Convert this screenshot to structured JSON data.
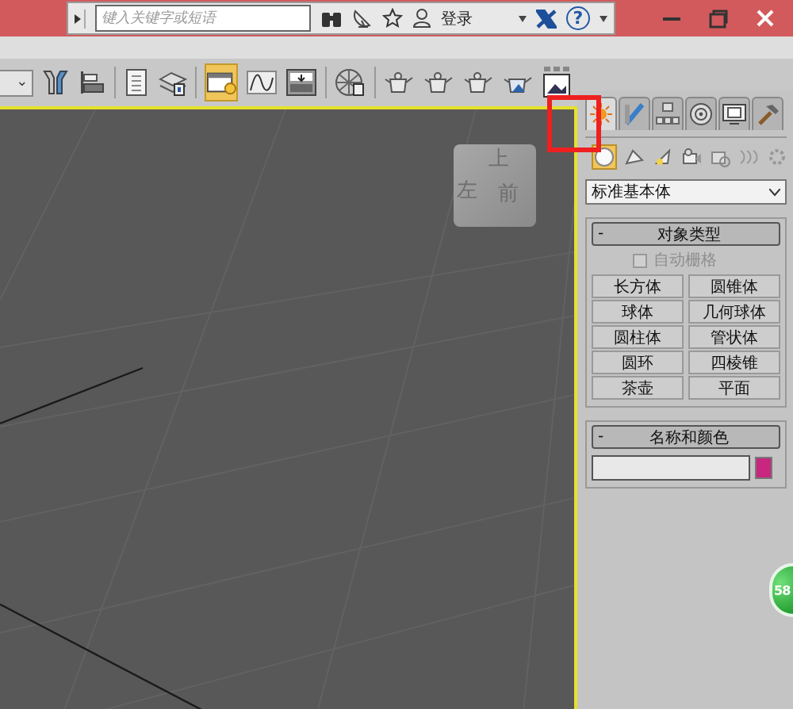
{
  "title_bar": {
    "search": {
      "placeholder": "键入关键字或短语"
    },
    "login": "登录",
    "help": "?"
  },
  "toolbar": {
    "dropdown_caret": "⌄",
    "tools": [
      {
        "kind": "mirror",
        "selected": false
      },
      {
        "kind": "align",
        "selected": false
      },
      {
        "kind": "list",
        "selected": false
      },
      {
        "kind": "layers",
        "selected": false
      },
      {
        "kind": "folder",
        "selected": true
      },
      {
        "kind": "curve",
        "selected": false
      },
      {
        "kind": "schematic",
        "selected": false
      },
      {
        "kind": "sphere",
        "selected": false
      },
      {
        "kind": "teapot",
        "selected": false
      },
      {
        "kind": "teapot",
        "selected": false
      },
      {
        "kind": "teapot",
        "selected": false
      },
      {
        "kind": "teapot-blue",
        "selected": false
      },
      {
        "kind": "frame",
        "selected": false
      }
    ]
  },
  "viewcube": {
    "faces": [
      "上",
      "左",
      "前"
    ]
  },
  "command_panel": {
    "tabs": [
      {
        "kind": "create",
        "selected": true
      },
      {
        "kind": "modify",
        "selected": false
      },
      {
        "kind": "hierarchy",
        "selected": false
      },
      {
        "kind": "motion",
        "selected": false
      },
      {
        "kind": "display",
        "selected": false
      },
      {
        "kind": "utilities",
        "selected": false
      }
    ],
    "categories": [
      {
        "kind": "geometry",
        "selected": true
      },
      {
        "kind": "shapes",
        "selected": false
      },
      {
        "kind": "lights",
        "selected": false
      },
      {
        "kind": "cameras",
        "selected": false
      },
      {
        "kind": "helpers",
        "selected": false
      },
      {
        "kind": "spacewarps",
        "selected": false
      },
      {
        "kind": "systems",
        "selected": false
      }
    ],
    "dropdown": {
      "value": "标准基本体"
    },
    "object_type": {
      "collapse": "-",
      "title": "对象类型",
      "autogrid": {
        "label": "自动栅格",
        "checked": false,
        "disabled": true
      },
      "buttons": [
        "长方体",
        "圆锥体",
        "球体",
        "几何球体",
        "圆柱体",
        "管状体",
        "圆环",
        "四棱锥",
        "茶壶",
        "平面"
      ]
    },
    "name_and_color": {
      "collapse": "-",
      "title": "名称和颜色",
      "color": "#c8267f"
    }
  },
  "badge": "58"
}
